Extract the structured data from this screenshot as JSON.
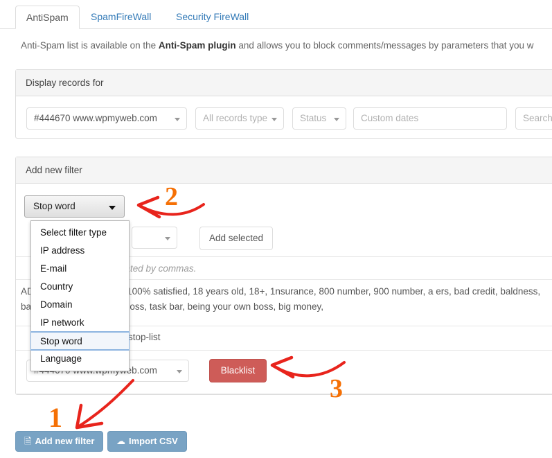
{
  "tabs": [
    {
      "label": "AntiSpam",
      "active": true
    },
    {
      "label": "SpamFireWall",
      "active": false
    },
    {
      "label": "Security FireWall",
      "active": false
    }
  ],
  "intro": {
    "prefix": "Anti-Spam list is available on the ",
    "strong": "Anti-Spam plugin",
    "suffix": " and allows you to block comments/messages by parameters that you w"
  },
  "display_panel": {
    "title": "Display records for",
    "site_select": "#444670 www.wpmyweb.com",
    "record_type_select": "All records type",
    "status_select": "Status",
    "custom_dates_placeholder": "Custom dates",
    "search_placeholder": "Search"
  },
  "filter_panel": {
    "title": "Add new filter",
    "filter_type_value": "Stop word",
    "dropdown_options": [
      "Select filter type",
      "IP address",
      "E-mail",
      "Country",
      "Domain",
      "IP network",
      "Stop word",
      "Language"
    ],
    "dropdown_selected": "Stop word",
    "second_select": "",
    "add_selected_label": "Add selected",
    "hint": "ntries separated by commas.",
    "words_line1": "ADV], 100% guaranteed, 100% satisfied, 18 years old, 18+, 1nsurance, 800 number, 900 number, a ",
    "words_line2": "ers, bad credit, baldness, bankruptcy, be your own boss, task bar, being your own boss, big money, ",
    "stoplist_label": "stop-list",
    "site_select2": "#444670 www.wpmyweb.com",
    "blacklist_label": "Blacklist"
  },
  "footer": {
    "add_new_filter_label": "Add new filter",
    "add_new_filter_icon": "document-icon",
    "import_csv_label": "Import CSV",
    "import_csv_icon": "cloud-upload-icon"
  },
  "annotations": [
    {
      "number": "1",
      "color": "#f57005"
    },
    {
      "number": "2",
      "color": "#f57005"
    },
    {
      "number": "3",
      "color": "#f57005"
    }
  ],
  "colors": {
    "accent_blue": "#337ab7",
    "danger_red": "#ce5c58",
    "button_blue": "#79a3c4",
    "annotation_orange": "#f57005",
    "arrow_red": "#e8241c"
  }
}
